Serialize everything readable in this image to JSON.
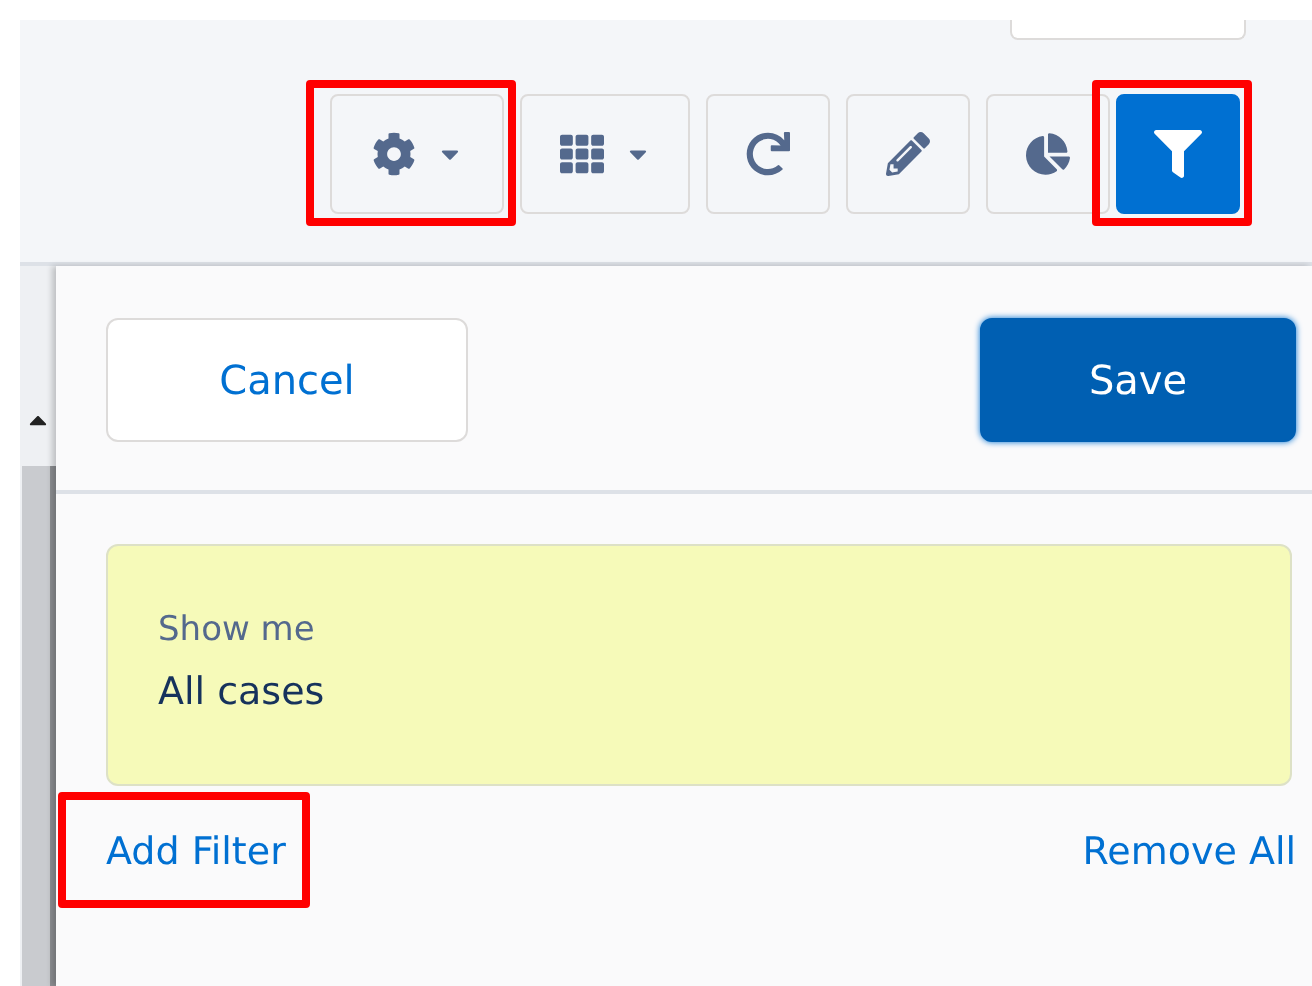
{
  "toolbar": [
    {
      "kind": "gear",
      "menu": true,
      "selected": false,
      "highlighted": true
    },
    {
      "kind": "table",
      "menu": true,
      "selected": false
    },
    {
      "kind": "refresh",
      "menu": false,
      "selected": false
    },
    {
      "kind": "pencil",
      "menu": false,
      "selected": false
    },
    {
      "kind": "pie",
      "menu": false,
      "selected": false
    },
    {
      "kind": "filter",
      "menu": false,
      "selected": true,
      "highlighted": true
    }
  ],
  "panel": {
    "cancel": "Cancel",
    "save": "Save",
    "filter": {
      "label": "Show me",
      "value": "All cases"
    },
    "add_filter": {
      "label": "Add Filter",
      "highlighted": true
    },
    "remove_all": "Remove All"
  }
}
